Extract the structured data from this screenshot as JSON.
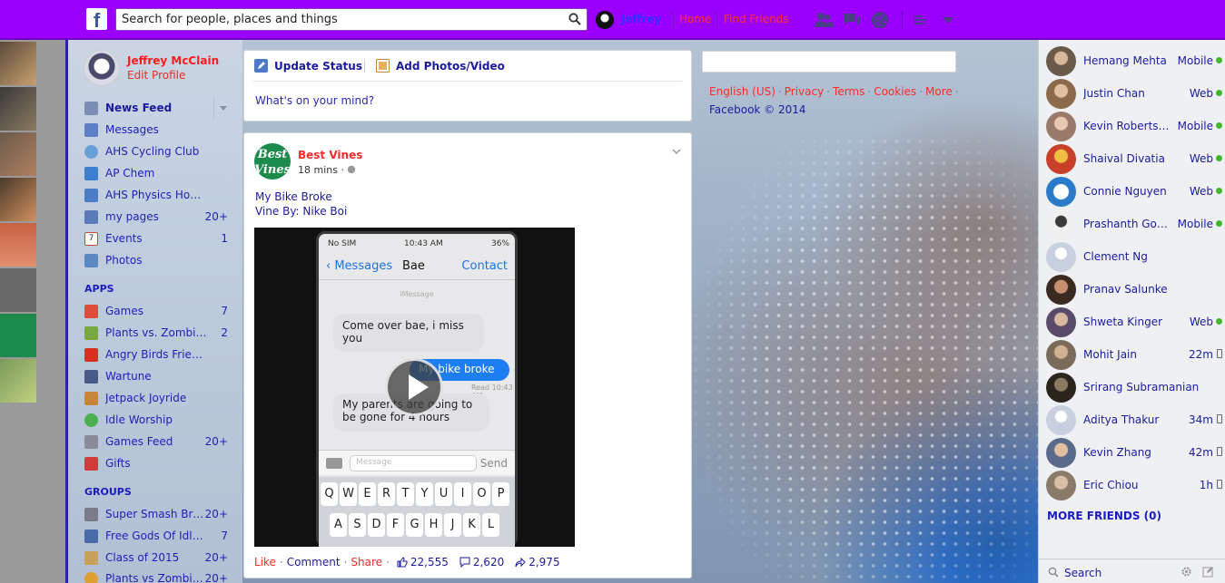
{
  "topbar": {
    "logo": "f",
    "search_placeholder": "Search for people, places and things",
    "user_name": "Jeffrey",
    "home": "Home",
    "find_friends": "Find Friends"
  },
  "profile": {
    "name": "Jeffrey McClain",
    "edit": "Edit Profile"
  },
  "nav": {
    "favorites": [
      {
        "label": "News Feed",
        "count": "",
        "color": "#7b8fb5"
      },
      {
        "label": "Messages",
        "count": "",
        "color": "#5d7fc7"
      },
      {
        "label": "AHS Cycling Club",
        "count": "",
        "color": "#6aa0d8"
      },
      {
        "label": "AP Chem",
        "count": "",
        "color": "#3b80d0"
      },
      {
        "label": "AHS Physics Honors",
        "count": "",
        "color": "#4b7cc8"
      },
      {
        "label": "my pages",
        "count": "20+",
        "color": "#5a7ab8"
      },
      {
        "label": "Events",
        "count": "1",
        "color": "#c94a3a"
      },
      {
        "label": "Photos",
        "count": "",
        "color": "#5b8ac2"
      }
    ],
    "apps_heading": "APPS",
    "apps": [
      {
        "label": "Games",
        "count": "7",
        "color": "#e04b3a"
      },
      {
        "label": "Plants vs. Zombies ...",
        "count": "2",
        "color": "#7aa840"
      },
      {
        "label": "Angry Birds Friends",
        "count": "",
        "color": "#d83020"
      },
      {
        "label": "Wartune",
        "count": "",
        "color": "#4a5a88"
      },
      {
        "label": "Jetpack Joyride",
        "count": "",
        "color": "#c8863a"
      },
      {
        "label": "Idle Worship",
        "count": "",
        "color": "#4caf50"
      },
      {
        "label": "Games Feed",
        "count": "20+",
        "color": "#8a8a9a"
      },
      {
        "label": "Gifts",
        "count": "",
        "color": "#d23a3a"
      }
    ],
    "groups_heading": "GROUPS",
    "groups": [
      {
        "label": "Super Smash Bro...",
        "count": "20+",
        "color": "#7a7a8a"
      },
      {
        "label": "Free Gods Of Idle ...",
        "count": "7",
        "color": "#4a6aa8"
      },
      {
        "label": "Class of 2015",
        "count": "20+",
        "color": "#c8a05a"
      },
      {
        "label": "Plants vs Zombie...",
        "count": "20+",
        "color": "#e0a030"
      }
    ]
  },
  "composer": {
    "update_status": "Update Status",
    "add_photos": "Add Photos/Video",
    "prompt": "What's on your mind?"
  },
  "post": {
    "author": "Best Vines",
    "avatar_text": "Best Vines",
    "time": "18 mins ·",
    "line1": "My Bike Broke",
    "line2": "Vine By: Nike Boi",
    "like": "Like",
    "comment": "Comment",
    "share": "Share",
    "likes": "22,555",
    "comments": "2,620",
    "shares": "2,975",
    "video": {
      "status_left": "No SIM",
      "status_time": "10:43 AM",
      "status_right": "36%",
      "back": "Messages",
      "contact_name": "Bae",
      "contact": "Contact",
      "imessage": "iMessage",
      "msg1": "Come over bae, i miss you",
      "msg2": "My bike broke",
      "read": "Read 10:43 AM",
      "msg3": "My parents are going to be gone for 4 hours",
      "input_placeholder": "Message",
      "send": "Send",
      "row1": [
        "Q",
        "W",
        "E",
        "R",
        "T",
        "Y",
        "U",
        "I",
        "O",
        "P"
      ],
      "row2": [
        "A",
        "S",
        "D",
        "F",
        "G",
        "H",
        "J",
        "K",
        "L"
      ]
    }
  },
  "footer": {
    "english": "English (US)",
    "privacy": "Privacy",
    "terms": "Terms",
    "cookies": "Cookies",
    "more": "More",
    "copyright": "Facebook © 2014"
  },
  "chat": {
    "friends": [
      {
        "name": "Hemang Mehta",
        "status": "Mobile",
        "indicator": "dot",
        "color": "#6a5a4a"
      },
      {
        "name": "Justin Chan",
        "status": "Web",
        "indicator": "dot",
        "color": "#8a6a4a"
      },
      {
        "name": "Kevin Robertson",
        "status": "Mobile",
        "indicator": "dot",
        "color": "#9a7a6a"
      },
      {
        "name": "Shaival Divatia",
        "status": "Web",
        "indicator": "dot",
        "color": "#c8402a"
      },
      {
        "name": "Connie Nguyen",
        "status": "Web",
        "indicator": "dot",
        "color": "#2a7ac8"
      },
      {
        "name": "Prashanth Gogi...",
        "status": "Mobile",
        "indicator": "dot",
        "color": "#3a3a3a"
      },
      {
        "name": "Clement Ng",
        "status": "",
        "indicator": "none",
        "color": "#c8d0e0"
      },
      {
        "name": "Pranav Salunke",
        "status": "",
        "indicator": "none",
        "color": "#6a4a3a"
      },
      {
        "name": "Shweta Kinger",
        "status": "Web",
        "indicator": "dot",
        "color": "#5a4a6a"
      },
      {
        "name": "Mohit Jain",
        "status": "22m",
        "indicator": "phone",
        "color": "#7a6a5a"
      },
      {
        "name": "Srirang Subramanian",
        "status": "",
        "indicator": "none",
        "color": "#3a3228"
      },
      {
        "name": "Aditya Thakur",
        "status": "34m",
        "indicator": "phone",
        "color": "#c8d0e0"
      },
      {
        "name": "Kevin Zhang",
        "status": "42m",
        "indicator": "phone",
        "color": "#5a6a8a"
      },
      {
        "name": "Eric Chiou",
        "status": "1h",
        "indicator": "phone",
        "color": "#8a7a6a"
      }
    ],
    "more_friends": "MORE FRIENDS (0)",
    "search": "Search"
  },
  "colors": {
    "topbar": "#9b00ff",
    "link_red": "#ff2a2a",
    "link_blue": "#1b1b9e",
    "online": "#42b72a"
  }
}
